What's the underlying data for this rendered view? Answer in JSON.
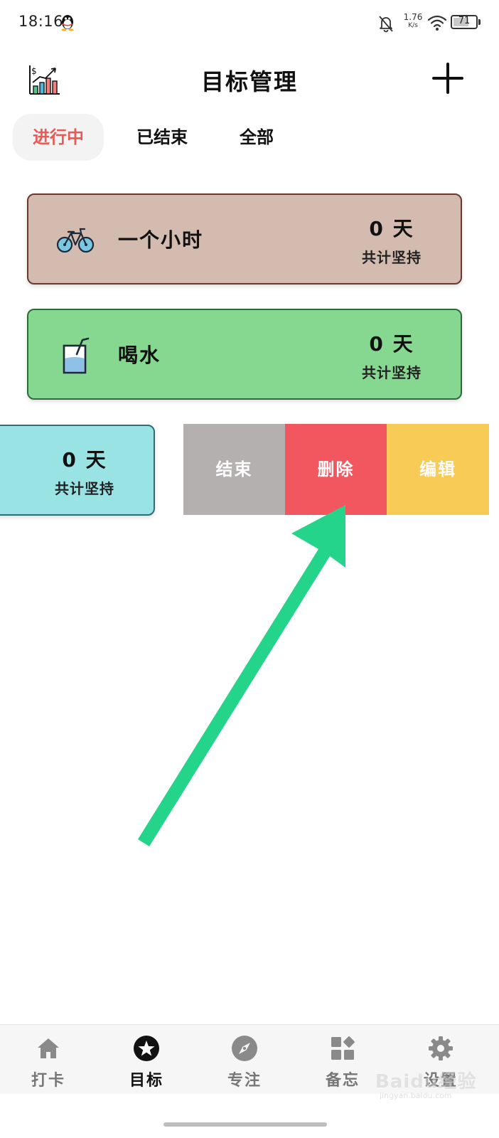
{
  "status_bar": {
    "time": "18:16",
    "net_speed_value": "1.76",
    "net_speed_unit": "K/s",
    "battery": "71",
    "battery_level": 0.71
  },
  "header": {
    "title": "目标管理"
  },
  "tabs": [
    {
      "label": "进行中",
      "active": true
    },
    {
      "label": "已结束",
      "active": false
    },
    {
      "label": "全部",
      "active": false
    }
  ],
  "goals": [
    {
      "name": "一个小时",
      "days": "0 天",
      "days_label": "共计坚持",
      "icon": "bicycle-icon",
      "color": "#d3bbb0",
      "border": "#6b3a2e"
    },
    {
      "name": "喝水",
      "days": "0 天",
      "days_label": "共计坚持",
      "icon": "water-cup-icon",
      "color": "#86d891",
      "border": "#2e6b3a"
    },
    {
      "name": "",
      "days": "0 天",
      "days_label": "共计坚持",
      "icon": "",
      "color": "#9ae3e5",
      "border": "#2f6d76"
    }
  ],
  "swipe_actions": [
    {
      "label": "结束",
      "color": "#b4b0b0"
    },
    {
      "label": "删除",
      "color": "#f2565f"
    },
    {
      "label": "编辑",
      "color": "#f8cb56"
    }
  ],
  "annotation_color": "#24d48a",
  "bottom_nav": [
    {
      "label": "打卡",
      "icon": "home-icon",
      "active": false
    },
    {
      "label": "目标",
      "icon": "star-icon",
      "active": true
    },
    {
      "label": "专注",
      "icon": "compass-icon",
      "active": false
    },
    {
      "label": "备忘",
      "icon": "widgets-icon",
      "active": false
    },
    {
      "label": "设置",
      "icon": "gear-icon",
      "active": false
    }
  ],
  "watermark": {
    "main": "Baidu经验",
    "sub": "jingyan.baidu.com"
  }
}
